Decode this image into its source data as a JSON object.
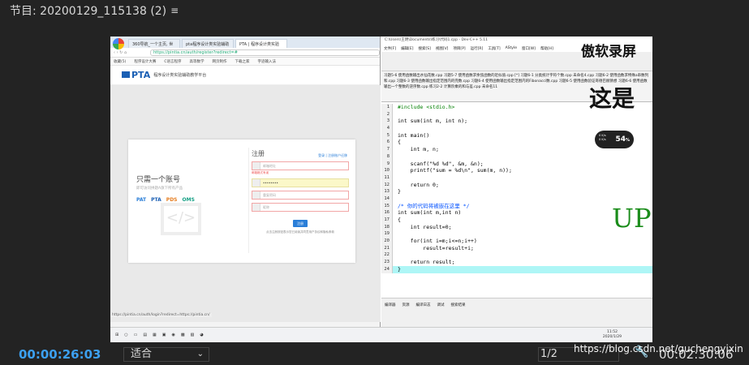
{
  "header": {
    "title": "节目: 20200129_115138 (2)",
    "menu_icon": "≡"
  },
  "browser": {
    "tabs": [
      "360导航_一个主页, 世",
      "pta程序设计类实验辅助",
      "PTA | 程序设计类实验"
    ],
    "url": "https://pintia.cn/auth/register?redirect=#",
    "bookmarks": [
      "收藏(5)",
      "程序设计大赛",
      "C语言程序",
      "高等数学",
      "网页制作",
      "下载之家",
      "字迹输入法"
    ],
    "site_title": "PTA",
    "site_subtitle": "程序设计类实验辅助教学平台",
    "card_heading": "只需一个账号",
    "card_subheading": "即可访问拼题A旗下所有产品",
    "brands": [
      "PAT",
      "PTA",
      "PDS",
      "OMS"
    ],
    "register_title": "注册",
    "register_links": "登录 | 注册账户迁移",
    "email_placeholder": "邮箱地址",
    "email_error": "邮箱格式有误",
    "password_value": "••••••••",
    "confirm_placeholder": "重复密码",
    "nickname_placeholder": "昵称",
    "register_button": "注册",
    "agree_text": "点击注册按钮表示您已阅读并同意用户协议和隐私条款",
    "status_url": "https://pintia.cn/auth/login?redirect=https://pintia.cn/"
  },
  "ide": {
    "title": "C:\\Users\\王明\\Documents\\练习\\代码1.cpp - Dev-C++ 5.11",
    "menu": [
      "文件[F]",
      "编辑[E]",
      "搜索[S]",
      "视图[V]",
      "项目[P]",
      "运行[R]",
      "工具[T]",
      "AStyle",
      "窗口[W]",
      "帮助[H]"
    ],
    "file_tabs": "习题5-6 使用函数输出水仙花数.cpp  习题5-7 使用函数求余弦函数的近似值.cpp  [*] 习题6-1 分类统计字符个数.cpp  未命名4.cpp  习题6-2 使用函数求特殊a串数列和.cpp  习题6-3 使用函数输出指定范围内的完数.cpp  习题6-4 使用函数输出指定范围内的Fibonacci数.cpp  习题6-5 使用函数验证哥德巴赫猜想  习题6-6 使用函数输出一个整数的逆序数.cpp  练习2-2 计算阶乘的和与差.cpp  未命名11",
    "code_lines": [
      {
        "n": "1",
        "t": "#include <stdio.h>",
        "c": "pre"
      },
      {
        "n": "2",
        "t": "",
        "c": ""
      },
      {
        "n": "3",
        "t": "int sum(int m, int n);",
        "c": ""
      },
      {
        "n": "4",
        "t": "",
        "c": ""
      },
      {
        "n": "5",
        "t": "int main()",
        "c": ""
      },
      {
        "n": "6",
        "t": "{",
        "c": ""
      },
      {
        "n": "7",
        "t": "    int m, n;",
        "c": ""
      },
      {
        "n": "8",
        "t": "",
        "c": ""
      },
      {
        "n": "9",
        "t": "    scanf(\"%d %d\", &m, &n);",
        "c": ""
      },
      {
        "n": "10",
        "t": "    printf(\"sum = %d\\n\", sum(m, n));",
        "c": ""
      },
      {
        "n": "11",
        "t": "",
        "c": ""
      },
      {
        "n": "12",
        "t": "    return 0;",
        "c": ""
      },
      {
        "n": "13",
        "t": "}",
        "c": ""
      },
      {
        "n": "14",
        "t": "",
        "c": ""
      },
      {
        "n": "15",
        "t": "/* 你的代码将被嵌在这里 */",
        "c": "cmt"
      },
      {
        "n": "16",
        "t": "int sum(int m,int n)",
        "c": ""
      },
      {
        "n": "17",
        "t": "{",
        "c": ""
      },
      {
        "n": "18",
        "t": "    int result=0;",
        "c": ""
      },
      {
        "n": "19",
        "t": "",
        "c": ""
      },
      {
        "n": "20",
        "t": "    for(int i=m;i<=n;i++)",
        "c": ""
      },
      {
        "n": "21",
        "t": "        result=result+i;",
        "c": ""
      },
      {
        "n": "22",
        "t": "",
        "c": ""
      },
      {
        "n": "23",
        "t": "    return result;",
        "c": ""
      },
      {
        "n": "24",
        "t": "}",
        "c": "hl"
      }
    ],
    "bottom_tabs": [
      "编译器",
      "资源",
      "编译日志",
      "调试",
      "搜索结果"
    ]
  },
  "overlays": {
    "recorder": "傲软录屏",
    "big_text": "这是",
    "speed": "54",
    "speed_unit": "%",
    "up_text": "UP"
  },
  "taskbar": {
    "time": "11:52",
    "date": "2020/1/29"
  },
  "footer": {
    "timecode": "00:00:26:03",
    "fit_label": "适合",
    "page": "1/2",
    "total": "00:02:30:06",
    "watermark": "https://blog.csdn.net/guchengyixin"
  }
}
